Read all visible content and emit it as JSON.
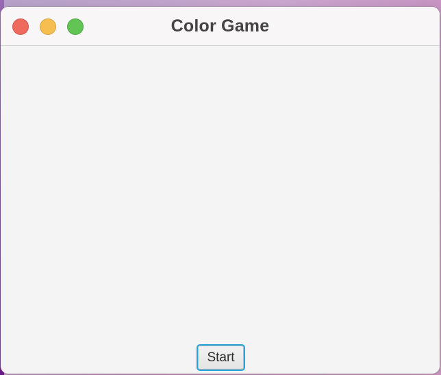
{
  "window": {
    "title": "Color Game",
    "controls": {
      "close": "close-button",
      "minimize": "minimize-button",
      "zoom": "zoom-button"
    }
  },
  "main": {
    "start_label": "Start"
  },
  "colors": {
    "close": "#ee6a5e",
    "minimize": "#f5be4f",
    "zoom": "#61c454",
    "focus_ring": "#2aa3d8",
    "content_bg": "#f4f4f4"
  }
}
